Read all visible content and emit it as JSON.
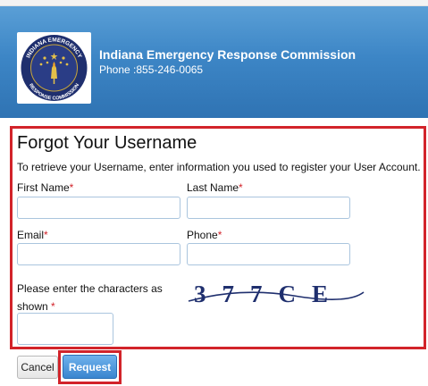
{
  "header": {
    "title": "Indiana Emergency Response Commission",
    "phone": "Phone :855-246-0065",
    "logo_text_top": "INDIANA EMERGENCY",
    "logo_text_bottom": "RESPONSE COMMISSION",
    "gradient_colors": [
      "#5a9fd6",
      "#2f73b3"
    ]
  },
  "form": {
    "title": "Forgot Your Username",
    "intro": "To retrieve your Username, enter information you used to register your User Account.",
    "required_marker": "*",
    "fields": {
      "first_name": {
        "label": "First Name",
        "value": ""
      },
      "last_name": {
        "label": "Last Name",
        "value": ""
      },
      "email": {
        "label": "Email",
        "value": ""
      },
      "phone": {
        "label": "Phone",
        "value": ""
      },
      "captcha": {
        "label": "Please enter the characters as shown",
        "value": ""
      }
    },
    "captcha_image_text": "377CE"
  },
  "buttons": {
    "cancel": "Cancel",
    "request": "Request"
  },
  "colors": {
    "highlight_border": "#d2232a",
    "required": "#d2232a",
    "primary_button": "#3a85cf"
  }
}
